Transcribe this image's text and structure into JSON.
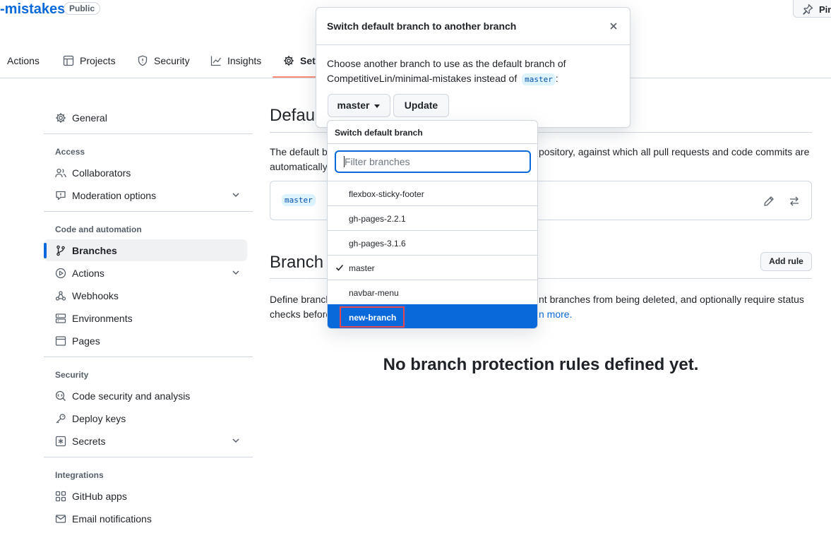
{
  "header": {
    "repo_name": "-mistakes",
    "visibility_badge": "Public",
    "pin_label": "Pin",
    "tabs": [
      {
        "label": "Actions",
        "icon": "play-icon"
      },
      {
        "label": "Projects",
        "icon": "table-icon"
      },
      {
        "label": "Security",
        "icon": "shield-icon"
      },
      {
        "label": "Insights",
        "icon": "graph-icon"
      },
      {
        "label": "Set",
        "icon": "gear-icon"
      }
    ]
  },
  "sidebar": {
    "general": "General",
    "access_heading": "Access",
    "collaborators": "Collaborators",
    "moderation": "Moderation options",
    "code_heading": "Code and automation",
    "branches": "Branches",
    "actions": "Actions",
    "webhooks": "Webhooks",
    "environments": "Environments",
    "pages": "Pages",
    "security_heading": "Security",
    "code_security": "Code security and analysis",
    "deploy_keys": "Deploy keys",
    "secrets": "Secrets",
    "integrations_heading": "Integrations",
    "github_apps": "GitHub apps",
    "email_notifications": "Email notifications"
  },
  "main": {
    "default_heading": "Defau",
    "default_desc_left_1": "The default b",
    "default_desc_right_1": "pository, against which all pull requests and code commits are",
    "default_desc_left_2": "automatically",
    "default_branch_value": "master",
    "protection_heading": "Branch",
    "add_rule": "Add rule",
    "protection_desc_left_1": "Define branch",
    "protection_desc_right_1": "nt branches from being deleted, and optionally require status",
    "protection_desc_left_2": "checks before",
    "learn_more": "n more.",
    "empty_message": "No branch protection rules defined yet."
  },
  "dialog": {
    "title": "Switch default branch to another branch",
    "body_line1": "Choose another branch to use as the default branch of",
    "body_line2": "CompetitiveLin/minimal-mistakes instead of",
    "current_branch": "master",
    "colon": ":",
    "branch_button": "master",
    "update_button": "Update"
  },
  "dropdown": {
    "header": "Switch default branch",
    "filter_placeholder": "Filter branches",
    "items": [
      {
        "label": "flexbox-sticky-footer",
        "selected": false,
        "highlighted": false
      },
      {
        "label": "gh-pages-2.2.1",
        "selected": false,
        "highlighted": false
      },
      {
        "label": "gh-pages-3.1.6",
        "selected": false,
        "highlighted": false
      },
      {
        "label": "master",
        "selected": true,
        "highlighted": false
      },
      {
        "label": "navbar-menu",
        "selected": false,
        "highlighted": false
      },
      {
        "label": "new-branch",
        "selected": false,
        "highlighted": true
      }
    ]
  },
  "colors": {
    "link": "#0969da",
    "highlight": "#0969da",
    "annotation_box": "#e5484d",
    "tab_underline": "#fd8c73"
  }
}
